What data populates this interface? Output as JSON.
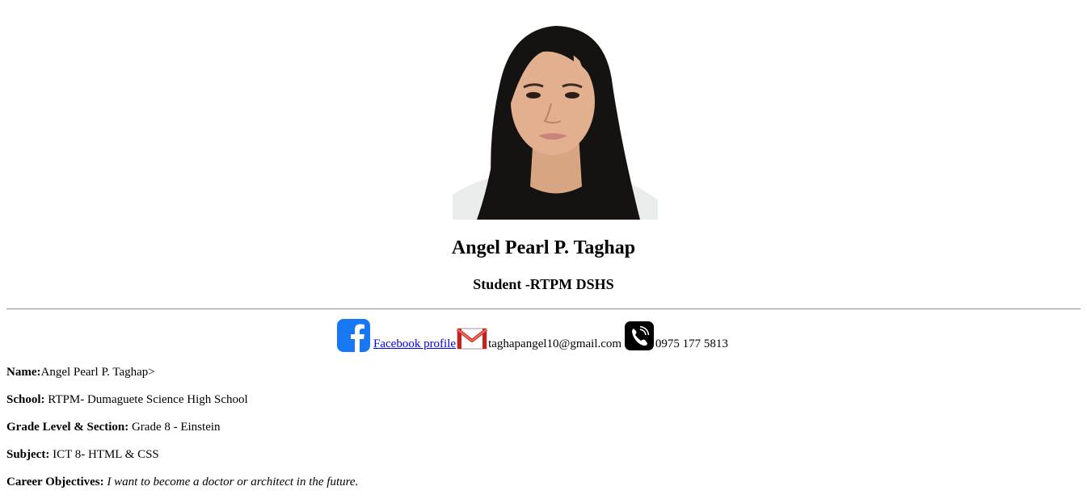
{
  "profile": {
    "full_name": "Angel Pearl P. Taghap",
    "role": "Student -RTPM DSHS"
  },
  "contact": {
    "facebook_label": "Facebook profile ",
    "email": "taghapangel10@gmail.com",
    "phone": "0975 177 5813",
    "icons": [
      "facebook-icon",
      "mail-icon",
      "phone-icon"
    ],
    "colors": {
      "facebook": "#1877f2",
      "mail_red": "#d93025",
      "phone_bg": "#000000",
      "link": "#0000ee"
    }
  },
  "details": {
    "name_label": "Name:",
    "name_value": "Angel Pearl P. Taghap>",
    "school_label": "School:",
    "school_value": " RTPM- Dumaguete Science High School",
    "grade_label": "Grade Level & Section:",
    "grade_value": " Grade 8 - Einstein",
    "subject_label": "Subject:",
    "subject_value": " ICT 8- HTML & CSS",
    "career_label": "Career Objectives:",
    "career_value": "I want to become a doctor or architect in the future."
  }
}
